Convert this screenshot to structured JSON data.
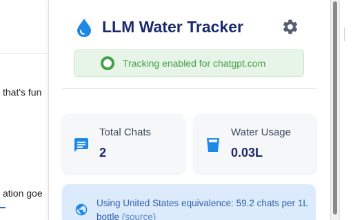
{
  "background": {
    "text_line_1": "that's fun",
    "text_line_2": "ation goe"
  },
  "popup": {
    "title": "LLM Water Tracker",
    "status": "Tracking enabled for chatgpt.com",
    "stats": [
      {
        "label": "Total Chats",
        "value": "2",
        "icon": "chat-icon"
      },
      {
        "label": "Water Usage",
        "value": "0.03L",
        "icon": "cup-icon"
      }
    ],
    "info": {
      "text": "Using United States equivalence: 59.2 chats per 1L bottle",
      "link_text": "(source)"
    }
  },
  "colors": {
    "title": "#1a2a6c",
    "accent_blue": "#1e88e5",
    "status_green": "#43a047",
    "status_bg": "#e7f4e8",
    "info_bg": "#dcebfc"
  }
}
